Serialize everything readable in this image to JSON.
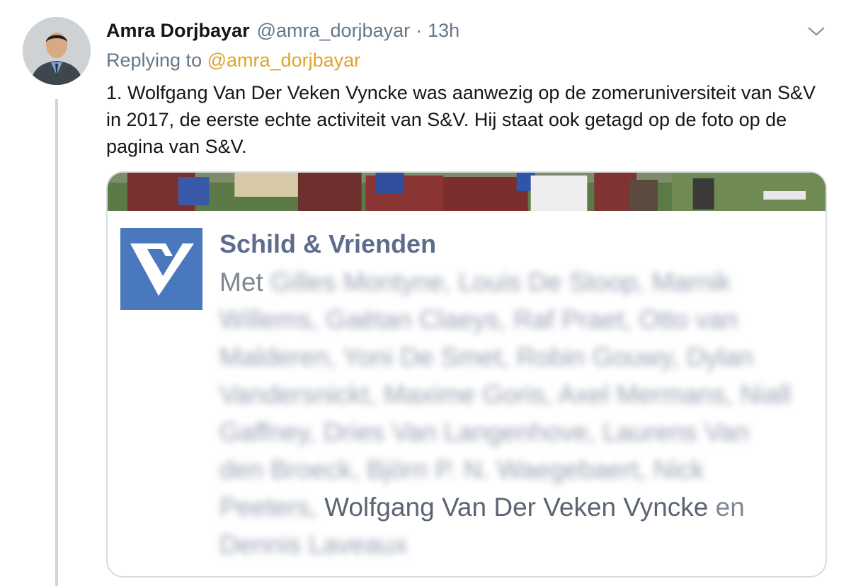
{
  "tweet": {
    "author_name": "Amra Dorjbayar",
    "author_handle": "@amra_dorjbayar",
    "separator": "·",
    "timestamp": "13h",
    "replying_prefix": "Replying to",
    "replying_to": "@amra_dorjbayar",
    "text": "1. Wolfgang Van Der Veken Vyncke was aanwezig op de zomeruniversiteit van S&V in 2017, de eerste echte activiteit van S&V. Hij staat ook getagd op de foto op de pagina van S&V."
  },
  "card": {
    "page_name": "Schild & Vrienden",
    "tag_prefix": "Met",
    "blurred_names_1": "Gilles Montyne, Louis De Stoop, Marnik Willems, Gaëtan Claeys, Raf Praet, Otto van Malderen, Yoni De Smet, Robin Gouwy, Dylan Vandersnickt, Maxime Goris, Axel Mermans, Niall Gaffney, Dries Van Langenhove, Laurens Van den Broeck, Björn P. N. Waegebaert, Nick Peeters,",
    "highlighted_name": "Wolfgang Van Der Veken Vyncke",
    "conjunction": "en",
    "blurred_names_2": "Dennis Laveaux"
  },
  "colors": {
    "link": "#e0a42a",
    "secondary": "#657786",
    "logo_blue": "#4a78bc",
    "fb_name": "#5d6c8c",
    "thread_line": "#ccd6dd"
  },
  "icons": {
    "more": "chevron-down-icon",
    "logo": "sv-logo-icon"
  }
}
